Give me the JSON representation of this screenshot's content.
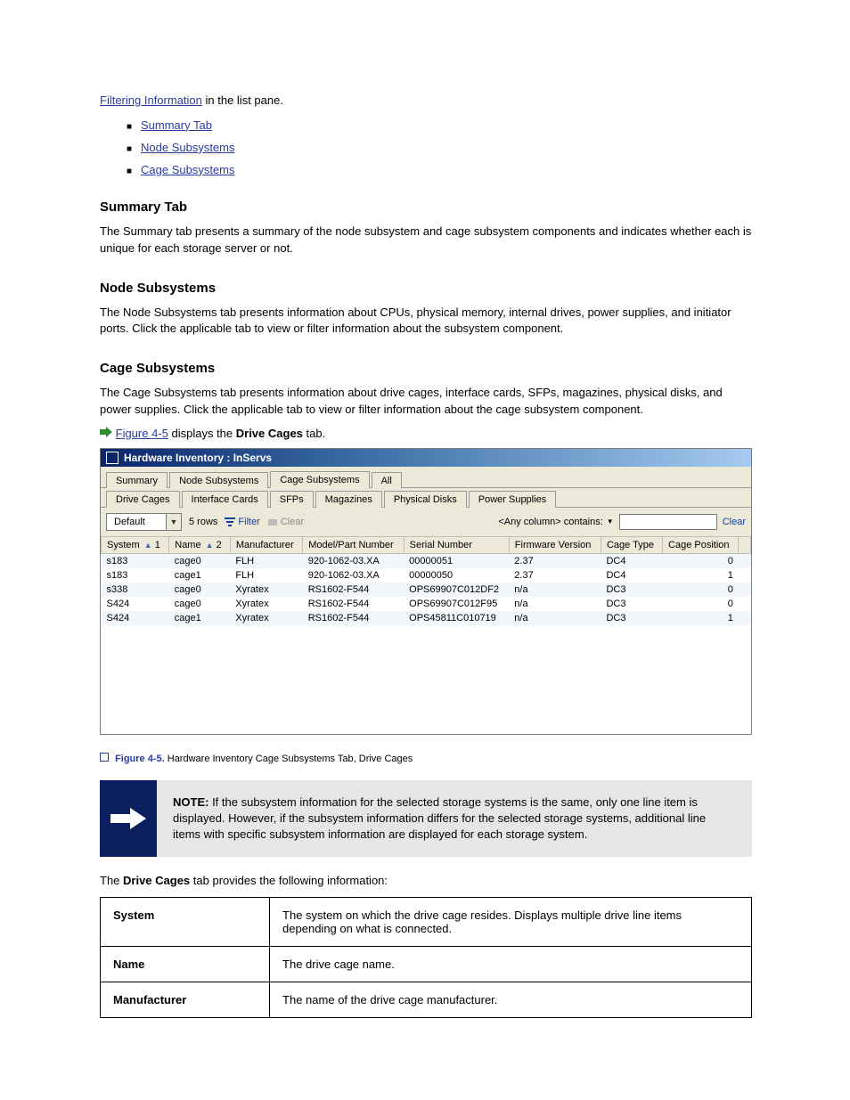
{
  "intro_link": "Filtering Information",
  "intro_tail": " in the list pane.",
  "link_items": [
    "Summary Tab",
    "Node Subsystems",
    "Cage Subsystems"
  ],
  "sections": {
    "summary": {
      "title": "Summary Tab",
      "text": "The Summary tab presents a summary of the node subsystem and cage subsystem components and indicates whether each is unique for each storage server or not."
    },
    "node": {
      "title": "Node Subsystems",
      "text": "The Node Subsystems tab presents information about CPUs, physical memory, internal drives, power supplies, and initiator ports. Click the applicable tab to view or filter information about the subsystem component."
    },
    "cage": {
      "title": "Cage Subsystems",
      "text": "The Cage Subsystems tab presents information about drive cages, interface cards, SFPs, magazines, physical disks, and power supplies. Click the applicable tab to view or filter information about the cage subsystem component.",
      "icon_label": "Figure 4-5",
      "icon_tail_1": " displays the ",
      "icon_tail_2_bold": "Drive Cages",
      "icon_tail_3": " tab."
    }
  },
  "caption": {
    "label": "Figure 4-5.",
    "text": "Hardware Inventory Cage Subsystems Tab, Drive Cages"
  },
  "screenshot": {
    "title": "Hardware Inventory : InServs",
    "main_tabs": [
      "Summary",
      "Node Subsystems",
      "Cage Subsystems",
      "All"
    ],
    "active_main_tab": 2,
    "sub_tabs": [
      "Drive Cages",
      "Interface Cards",
      "SFPs",
      "Magazines",
      "Physical Disks",
      "Power Supplies"
    ],
    "active_sub_tab": 0,
    "toolbar": {
      "combo_value": "Default",
      "row_count": "5 rows",
      "filter_label": "Filter",
      "clear_btn_label": "Clear",
      "search_drop": "<Any column> contains:",
      "search_value": "",
      "clear_link": "Clear"
    },
    "columns": [
      {
        "label": "System",
        "sort": "1"
      },
      {
        "label": "Name",
        "sort": "2"
      },
      {
        "label": "Manufacturer"
      },
      {
        "label": "Model/Part Number"
      },
      {
        "label": "Serial Number"
      },
      {
        "label": "Firmware Version"
      },
      {
        "label": "Cage Type"
      },
      {
        "label": "Cage Position"
      }
    ],
    "rows": [
      {
        "system": "s183",
        "name": "cage0",
        "mfr": "FLH",
        "model": "920-1062-03.XA",
        "serial": "00000051",
        "fw": "2.37",
        "type": "DC4",
        "pos": "0"
      },
      {
        "system": "s183",
        "name": "cage1",
        "mfr": "FLH",
        "model": "920-1062-03.XA",
        "serial": "00000050",
        "fw": "2.37",
        "type": "DC4",
        "pos": "1"
      },
      {
        "system": "s338",
        "name": "cage0",
        "mfr": "Xyratex",
        "model": "RS1602-F544",
        "serial": "OPS69907C012DF2",
        "fw": "n/a",
        "type": "DC3",
        "pos": "0"
      },
      {
        "system": "S424",
        "name": "cage0",
        "mfr": "Xyratex",
        "model": "RS1602-F544",
        "serial": "OPS69907C012F95",
        "fw": "n/a",
        "type": "DC3",
        "pos": "0"
      },
      {
        "system": "S424",
        "name": "cage1",
        "mfr": "Xyratex",
        "model": "RS1602-F544",
        "serial": "OPS45811C010719",
        "fw": "n/a",
        "type": "DC3",
        "pos": "1"
      }
    ]
  },
  "note": {
    "heading": "NOTE:",
    "body": " If the subsystem information for the selected storage systems is the same, only one line item is displayed. However, if the subsystem information differs for the selected storage systems, additional line items with specific subsystem information are displayed for each storage system.",
    "tail_lead": "The ",
    "tail_bold": "Drive Cages",
    "tail_rest": " tab provides the following information:"
  },
  "desc_table": [
    {
      "col": "System",
      "desc": "The system on which the drive cage resides. Displays multiple drive line items depending on what is connected."
    },
    {
      "col": "Name",
      "desc": "The drive cage name."
    },
    {
      "col": "Manufacturer",
      "desc": "The name of the drive cage manufacturer."
    }
  ]
}
